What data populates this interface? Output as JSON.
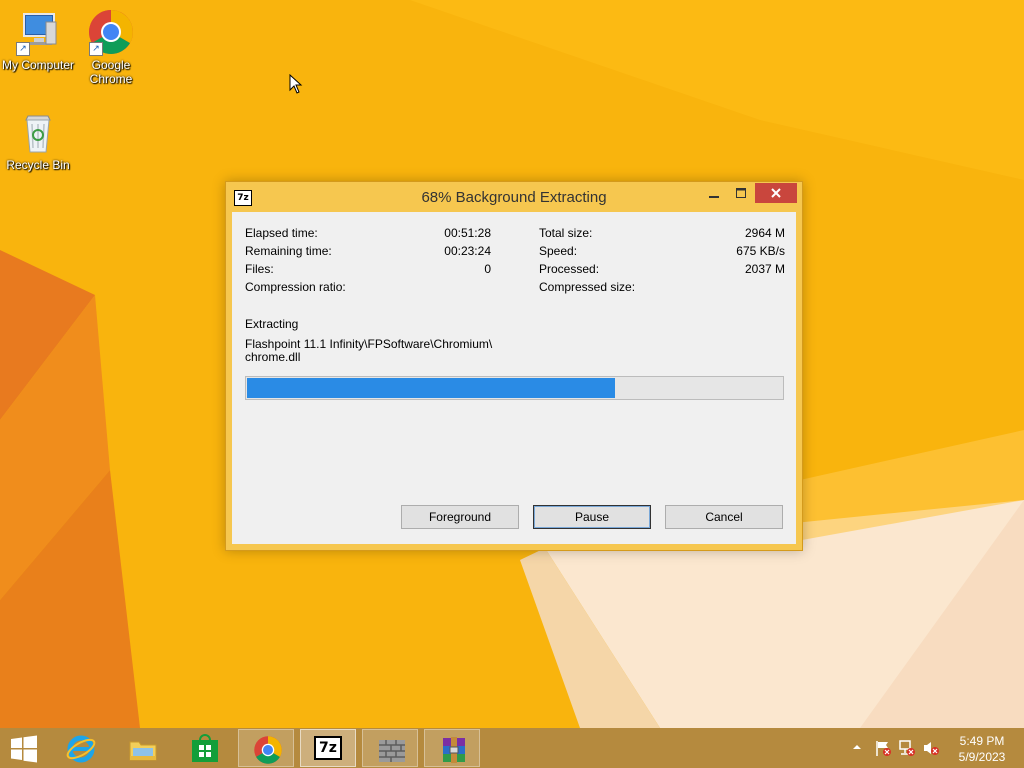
{
  "desktop": {
    "icons": [
      {
        "label": "My Computer"
      },
      {
        "label": "Google Chrome"
      },
      {
        "label": "Recycle Bin"
      }
    ]
  },
  "dialog": {
    "app_icon_text": "7z",
    "title": "68% Background Extracting",
    "stats_left": [
      {
        "label": "Elapsed time:",
        "value": "00:51:28"
      },
      {
        "label": "Remaining time:",
        "value": "00:23:24"
      },
      {
        "label": "Files:",
        "value": "0"
      },
      {
        "label": "Compression ratio:",
        "value": ""
      }
    ],
    "stats_right": [
      {
        "label": "Total size:",
        "value": "2964 M"
      },
      {
        "label": "Speed:",
        "value": "675 KB/s"
      },
      {
        "label": "Processed:",
        "value": "2037 M"
      },
      {
        "label": "Compressed size:",
        "value": ""
      }
    ],
    "status": "Extracting",
    "path_line1": "Flashpoint 11.1 Infinity\\FPSoftware\\Chromium\\",
    "path_line2": "chrome.dll",
    "progress_percent": 68.7,
    "buttons": {
      "foreground": "Foreground",
      "pause": "Pause",
      "cancel": "Cancel"
    }
  },
  "taskbar": {
    "pinned": [
      {
        "name": "start-button"
      },
      {
        "name": "internet-explorer"
      },
      {
        "name": "file-explorer"
      },
      {
        "name": "windows-store"
      },
      {
        "name": "google-chrome"
      },
      {
        "name": "7-zip"
      },
      {
        "name": "firewall"
      },
      {
        "name": "winrar"
      }
    ],
    "colors": {
      "background": "#b58a3e",
      "desktop": "#f9b40d",
      "progress": "#2a8be5",
      "close": "#c9463d"
    },
    "seven_zip_label": "7z",
    "clock": {
      "time": "5:49 PM",
      "date": "5/9/2023"
    }
  }
}
